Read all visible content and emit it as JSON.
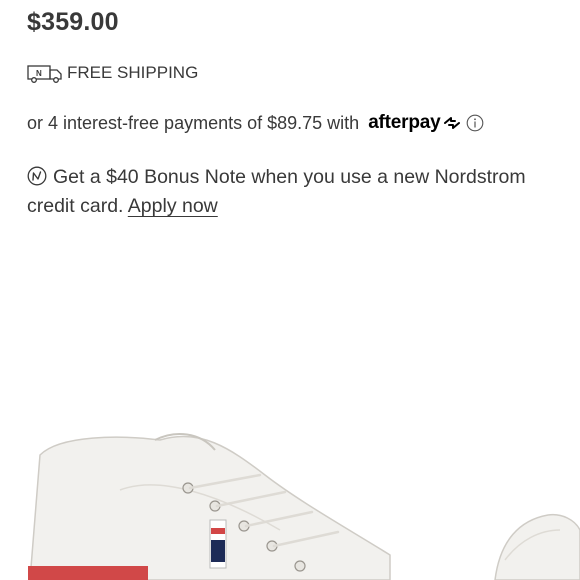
{
  "product": {
    "price": "$359.00"
  },
  "shipping": {
    "icon": "delivery-truck-icon",
    "label": "FREE SHIPPING"
  },
  "afterpay": {
    "text": "or 4 interest-free payments of $89.75 with",
    "brand": "afterpay",
    "info_icon": "info-icon"
  },
  "bonus_note": {
    "icon": "nordstrom-n-icon",
    "text": "Get a $40 Bonus Note when you use a new Nordstrom credit card.",
    "link_label": "Apply now"
  },
  "image": {
    "alt": "white leather low-top sneakers"
  }
}
